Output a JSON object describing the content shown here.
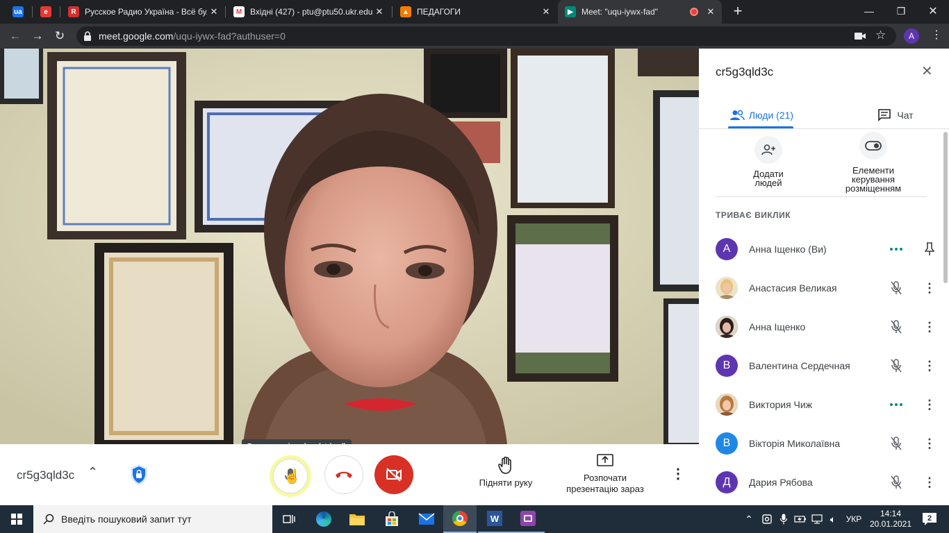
{
  "browser": {
    "tabs": [
      {
        "title": "",
        "favicon": "ukrnet-icon",
        "color": "#1a73e8"
      },
      {
        "title": "",
        "favicon": "e-icon",
        "color": "#e53935"
      },
      {
        "title": "Русское Радио Україна - Всё бу...",
        "favicon": "radio-icon",
        "color": "#d32f2f"
      },
      {
        "title": "Вхідні (427) - ptu@ptu50.ukr.edu...",
        "favicon": "gmail-icon",
        "color": "#ea4335"
      },
      {
        "title": "ПЕДАГОГИ",
        "favicon": "classroom-icon",
        "color": "#f57c00"
      },
      {
        "title": "Meet: \"uqu-iywx-fad\"",
        "favicon": "meet-icon",
        "color": "#00897b",
        "active": true
      }
    ],
    "url_host": "meet.google.com",
    "url_path": "/uqu-iywx-fad?authuser=0",
    "profile_initial": "A",
    "recording_color": "#ea4335"
  },
  "meet": {
    "meeting_code": "cr5g3qld3c",
    "tooltip": "Вимкнути мікрофон (ctrl + d)",
    "raise_hand_label": "Підняти руку",
    "present_label_line1": "Розпочати",
    "present_label_line2": "презентацію зараз"
  },
  "panel": {
    "title": "cr5g3qld3c",
    "tab_people": "Люди (21)",
    "tab_chat": "Чат",
    "add_people_line1": "Додати",
    "add_people_line2": "людей",
    "host_controls_line1": "Елементи",
    "host_controls_line2": "керування",
    "host_controls_line3": "розміщенням",
    "section_label": "ТРИВАЄ ВИКЛИК",
    "participants": [
      {
        "name": "Анна Іщенко (Ви)",
        "initial": "А",
        "avatar_color": "#5e35b1",
        "photo": false,
        "status": "speaking",
        "action": "pin"
      },
      {
        "name": "Анастасия Великая",
        "initial": "",
        "avatar_color": "#e0c89a",
        "photo": true,
        "status": "muted",
        "action": "more"
      },
      {
        "name": "Анна Іщенко",
        "initial": "",
        "avatar_color": "#3b2a22",
        "photo": true,
        "status": "muted",
        "action": "more"
      },
      {
        "name": "Валентина Сердечная",
        "initial": "В",
        "avatar_color": "#5e35b1",
        "photo": false,
        "status": "muted",
        "action": "more"
      },
      {
        "name": "Виктория Чиж",
        "initial": "",
        "avatar_color": "#c9955b",
        "photo": true,
        "status": "speaking",
        "action": "more"
      },
      {
        "name": "Вікторія Миколаївна",
        "initial": "В",
        "avatar_color": "#1e88e5",
        "photo": false,
        "status": "muted",
        "action": "more"
      },
      {
        "name": "Дария Рябова",
        "initial": "Д",
        "avatar_color": "#5e35b1",
        "photo": false,
        "status": "muted",
        "action": "more"
      }
    ]
  },
  "taskbar": {
    "search_placeholder": "Введіть пошуковий запит тут",
    "language": "УКР",
    "time": "14:14",
    "date": "20.01.2021",
    "notifications": "2"
  }
}
